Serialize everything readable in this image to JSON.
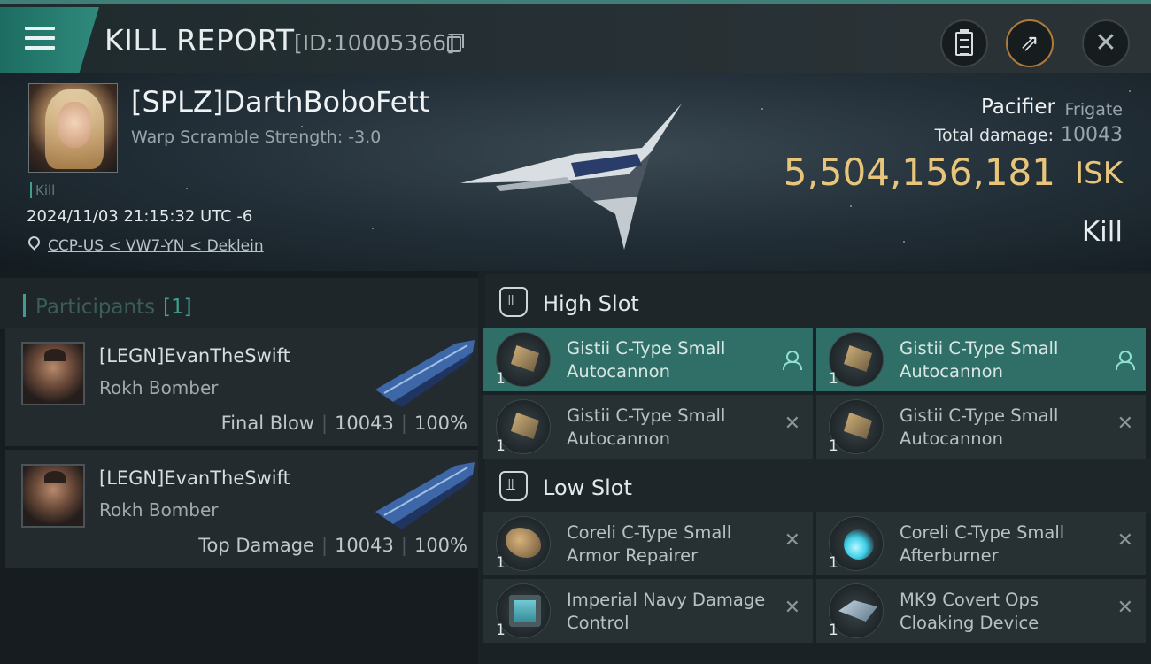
{
  "header": {
    "title": "KILL REPORT",
    "id_text": "[ID:10005366]"
  },
  "victim": {
    "name": "[SPLZ]DarthBoboFett",
    "warp_scramble": "Warp Scramble Strength: -3.0",
    "tag": "Kill",
    "timestamp": "2024/11/03 21:15:32 UTC -6",
    "location": "CCP-US < VW7-YN < Deklein",
    "ship_name": "Pacifier",
    "ship_class": "Frigate",
    "total_damage_label": "Total damage:",
    "total_damage": "10043",
    "isk_value": "5,504,156,181",
    "isk_label": "ISK",
    "result": "Kill"
  },
  "participants": {
    "title": "Participants",
    "count": "[1]",
    "items": [
      {
        "name": "[LEGN]EvanTheSwift",
        "ship": "Rokh Bomber",
        "role": "Final Blow",
        "damage": "10043",
        "percent": "100%"
      },
      {
        "name": "[LEGN]EvanTheSwift",
        "ship": "Rokh Bomber",
        "role": "Top Damage",
        "damage": "10043",
        "percent": "100%"
      }
    ]
  },
  "slots": {
    "high": {
      "label": "High Slot",
      "modules": [
        {
          "qty": "1",
          "name": "Gistii C-Type Small Autocannon",
          "status": "person"
        },
        {
          "qty": "1",
          "name": "Gistii C-Type Small Autocannon",
          "status": "person"
        },
        {
          "qty": "1",
          "name": "Gistii C-Type Small Autocannon",
          "status": "✕"
        },
        {
          "qty": "1",
          "name": "Gistii C-Type Small Autocannon",
          "status": "✕"
        }
      ]
    },
    "low": {
      "label": "Low Slot",
      "modules": [
        {
          "qty": "1",
          "name": "Coreli C-Type Small Armor Repairer",
          "status": "✕"
        },
        {
          "qty": "1",
          "name": "Coreli C-Type Small Afterburner",
          "status": "✕"
        },
        {
          "qty": "1",
          "name": "Imperial Navy Damage Control",
          "status": "✕"
        },
        {
          "qty": "1",
          "name": "MK9 Covert Ops Cloaking Device",
          "status": "✕"
        }
      ]
    }
  },
  "colors": {
    "accent": "#3f9e8e",
    "isk": "#e7c57b",
    "active_module": "#2f6f67"
  }
}
